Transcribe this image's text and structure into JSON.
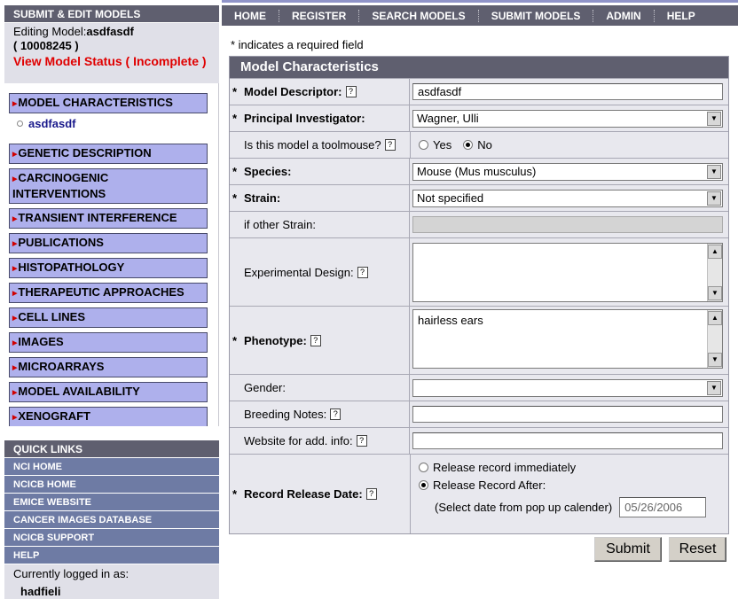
{
  "sidebar": {
    "title": "SUBMIT & EDIT MODELS",
    "editing_label": "Editing Model:",
    "editing_name": "asdfasdf",
    "model_id": "( 10008245 )",
    "status_link": "View Model Status ( Incomplete )",
    "nav": [
      {
        "label": "MODEL CHARACTERISTICS"
      },
      {
        "label": "GENETIC DESCRIPTION"
      },
      {
        "label": "CARCINOGENIC INTERVENTIONS"
      },
      {
        "label": "TRANSIENT INTERFERENCE"
      },
      {
        "label": "PUBLICATIONS"
      },
      {
        "label": "HISTOPATHOLOGY"
      },
      {
        "label": "THERAPEUTIC APPROACHES"
      },
      {
        "label": "CELL LINES"
      },
      {
        "label": "IMAGES"
      },
      {
        "label": "MICROARRAYS"
      },
      {
        "label": "MODEL AVAILABILITY"
      },
      {
        "label": "XENOGRAFT"
      }
    ],
    "sub_item": "asdfasdf",
    "quick_links_title": "QUICK LINKS",
    "quick_links": [
      "NCI HOME",
      "NCICB HOME",
      "EMICE WEBSITE",
      "CANCER IMAGES DATABASE",
      "NCICB SUPPORT",
      "HELP"
    ],
    "logged_in_label": "Currently logged in as:",
    "logged_in_user": "hadfieli"
  },
  "topnav": [
    "HOME",
    "REGISTER",
    "SEARCH MODELS",
    "SUBMIT MODELS",
    "ADMIN",
    "HELP"
  ],
  "required_note": "* indicates a required field",
  "form": {
    "title": "Model Characteristics",
    "star": "*",
    "help_glyph": "?",
    "model_descriptor": {
      "label": "Model Descriptor:",
      "value": "asdfasdf"
    },
    "principal_investigator": {
      "label": "Principal Investigator:",
      "value": "Wagner, Ulli"
    },
    "toolmouse": {
      "label": "Is this model a toolmouse?",
      "yes": "Yes",
      "no": "No",
      "selected": "No"
    },
    "species": {
      "label": "Species:",
      "value": "Mouse (Mus musculus)"
    },
    "strain": {
      "label": "Strain:",
      "value": "Not specified"
    },
    "other_strain": {
      "label": "if other Strain:",
      "value": ""
    },
    "experimental_design": {
      "label": "Experimental Design:",
      "value": ""
    },
    "phenotype": {
      "label": "Phenotype:",
      "value": "hairless ears"
    },
    "gender": {
      "label": "Gender:",
      "value": ""
    },
    "breeding_notes": {
      "label": "Breeding Notes:",
      "value": ""
    },
    "website": {
      "label": "Website for add. info:",
      "value": ""
    },
    "release": {
      "label": "Record Release Date:",
      "option_immediate": "Release record immediately",
      "option_after": "Release Record After:",
      "selected": "Release Record After:",
      "date_hint": "(Select date from pop up calender)",
      "date_value": "05/26/2006"
    }
  },
  "buttons": {
    "submit": "Submit",
    "reset": "Reset"
  }
}
